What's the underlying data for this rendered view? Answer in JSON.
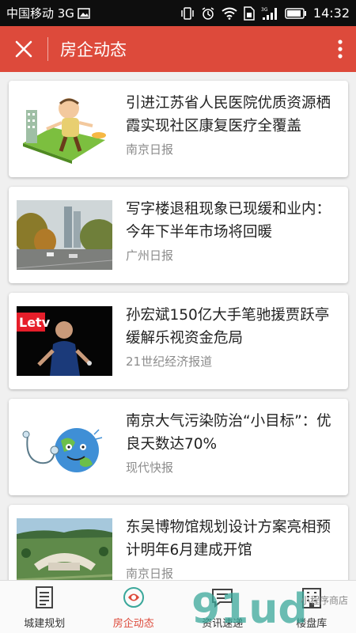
{
  "status_bar": {
    "carrier": "中国移动 3G",
    "network": "3G",
    "time": "14:32"
  },
  "header": {
    "title": "房企动态"
  },
  "articles": [
    {
      "title": "引进江苏省人民医院优质资源栖霞实现社区康复医疗全覆盖",
      "source": "南京日报",
      "thumb": "cartoon-man-illustration"
    },
    {
      "title": "写字楼退租现象已现缓和业内：今年下半年市场将回暖",
      "source": "广州日报",
      "thumb": "city-street-photo"
    },
    {
      "title": "孙宏斌150亿大手笔驰援贾跃亭缓解乐视资金危局",
      "source": "21世纪经济报道",
      "thumb": "letv-speaker-photo",
      "thumb_logo": "Letv"
    },
    {
      "title": "南京大气污染防治“小目标”：优良天数达70%",
      "source": "现代快报",
      "thumb": "earth-doctor-illustration"
    },
    {
      "title": "东吴博物馆规划设计方案亮相预计明年6月建成开馆",
      "source": "南京日报",
      "thumb": "museum-aerial-rendering"
    }
  ],
  "tabs": [
    {
      "label": "城建规划",
      "icon": "document-icon",
      "active": false
    },
    {
      "label": "房企动态",
      "icon": "news-icon",
      "active": true
    },
    {
      "label": "资讯速递",
      "icon": "chat-icon",
      "active": false
    },
    {
      "label": "楼盘库",
      "icon": "building-icon",
      "active": false
    }
  ],
  "watermark": {
    "text": "91ud",
    "sub": "小程序商店"
  },
  "colors": {
    "accent": "#dd4a3b",
    "status_bar": "#0e0e0e",
    "background": "#f0f0f0",
    "source_text": "#8c8c8c",
    "watermark": "#3aa79a"
  }
}
